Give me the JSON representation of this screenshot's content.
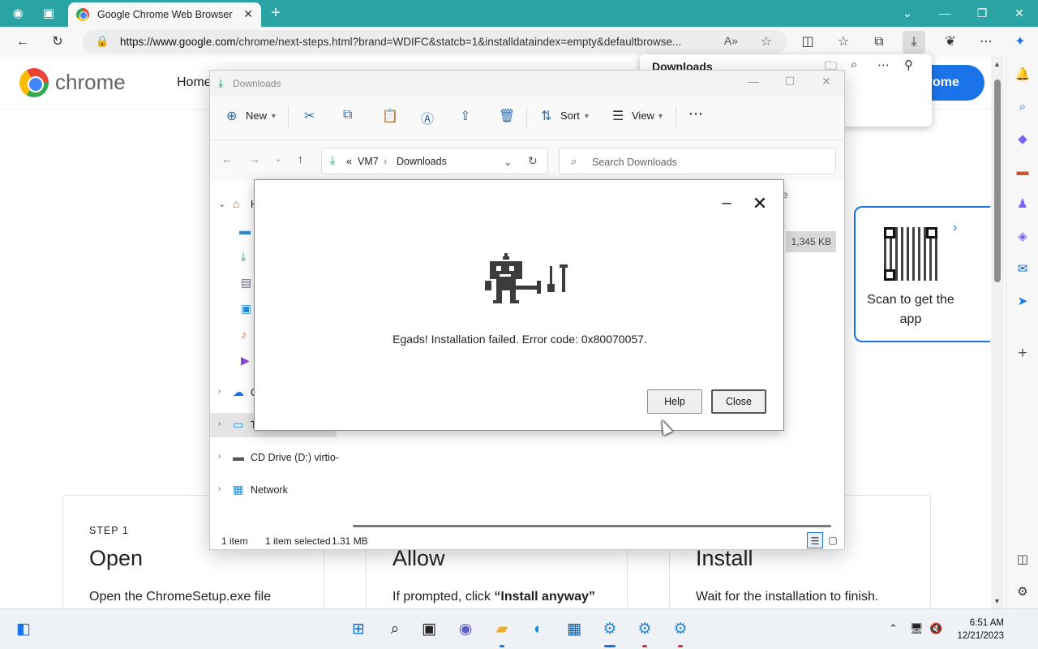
{
  "browser": {
    "tab_title": "Google Chrome Web Browser",
    "url_host": "https://www.google.com",
    "url_rest": "/chrome/next-steps.html?brand=WDIFC&statcb=1&installdataindex=empty&defaultbrowse..."
  },
  "page": {
    "brand": "chrome",
    "nav_home": "Home",
    "get_chrome_label": "hrome",
    "qr_text": "Scan to get the app",
    "steps": [
      {
        "label": "STEP 1",
        "title": "Open",
        "desc": "Open the ChromeSetup.exe file"
      },
      {
        "label": "",
        "title": "Allow",
        "desc_prefix": "If prompted, click ",
        "desc_bold": "“Install anyway”"
      },
      {
        "label": "",
        "title": "Install",
        "desc": "Wait for the installation to finish."
      }
    ]
  },
  "downloads_flyout": {
    "title": "Downloads"
  },
  "explorer": {
    "title": "Downloads",
    "cmd": {
      "new": "New",
      "sort": "Sort",
      "view": "View"
    },
    "path": {
      "root": "VM7",
      "folder": "Downloads"
    },
    "search_placeholder": "Search Downloads",
    "tree": {
      "home": "H",
      "onedrive": "C",
      "thispc": "T",
      "cd": "CD Drive (D:) virtio-",
      "network": "Network"
    },
    "col_size": "ze",
    "row_size": "1,345 KB",
    "status": {
      "count": "1 item",
      "selected": "1 item selected",
      "size": "1.31 MB"
    }
  },
  "dialog": {
    "message": "Egads! Installation failed. Error code: 0x80070057.",
    "help": "Help",
    "close": "Close"
  },
  "taskbar": {
    "time": "6:51 AM",
    "date": "12/21/2023"
  },
  "colors": {
    "accent": "#1a73e8",
    "tab_bar": "#29a3a3"
  }
}
